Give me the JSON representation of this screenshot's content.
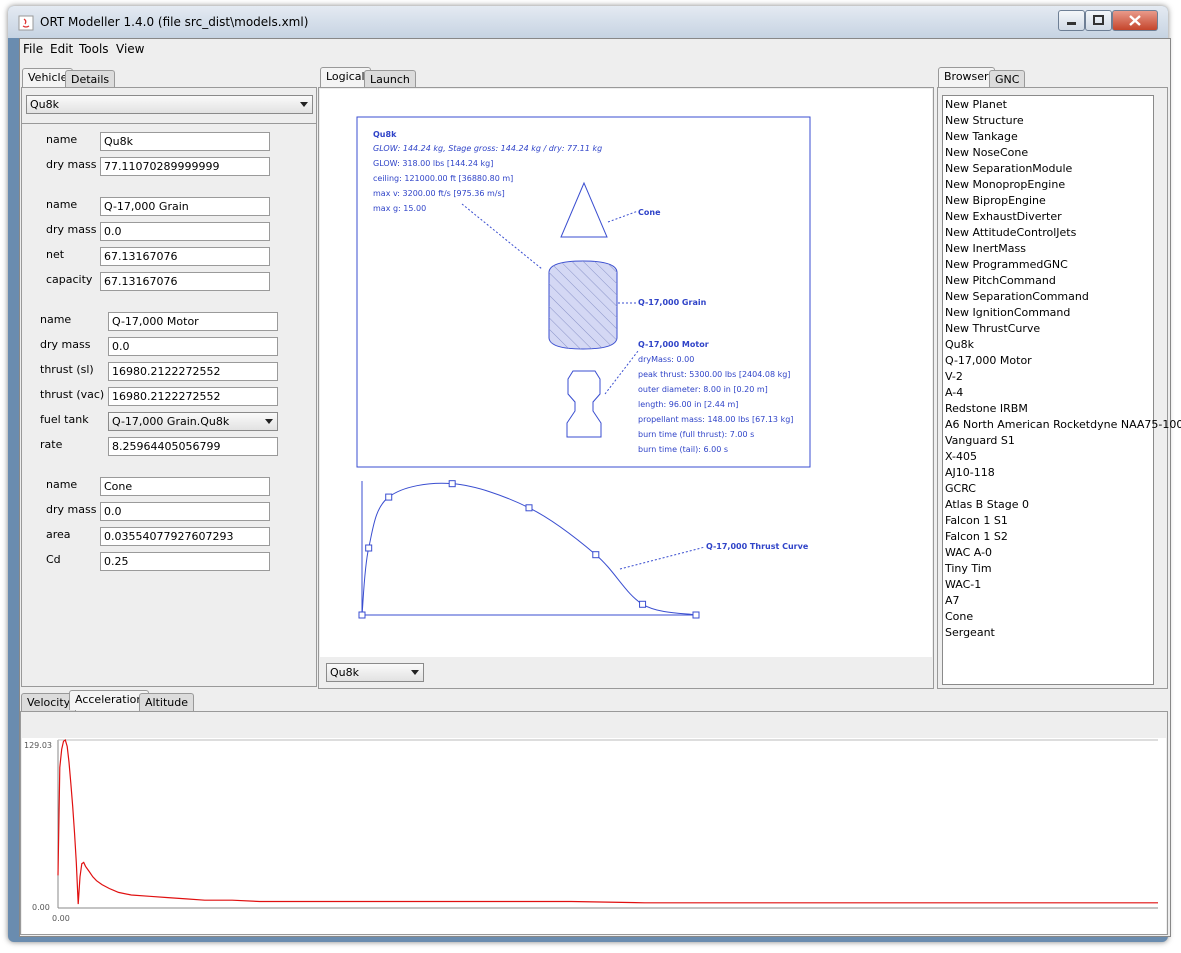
{
  "window": {
    "title": "ORT Modeller 1.4.0 (file src_dist\\models.xml)"
  },
  "menu": [
    "File",
    "Edit",
    "Tools",
    "View"
  ],
  "left": {
    "tabs": [
      "Vehicle",
      "Details"
    ],
    "selected_model": "Qu8k",
    "vehicle": {
      "name_label": "name",
      "name": "Qu8k",
      "dry_mass_label": "dry mass",
      "dry_mass": "77.11070289999999"
    },
    "tankage": {
      "name_label": "name",
      "name": "Q-17,000 Grain",
      "dry_mass_label": "dry mass",
      "dry_mass": "0.0",
      "net_label": "net",
      "net": "67.13167076",
      "capacity_label": "capacity",
      "capacity": "67.13167076"
    },
    "motor": {
      "name_label": "name",
      "name": "Q-17,000 Motor",
      "dry_mass_label": "dry mass",
      "dry_mass": "0.0",
      "thrust_sl_label": "thrust (sl)",
      "thrust_sl": "16980.2122272552",
      "thrust_vac_label": "thrust (vac)",
      "thrust_vac": "16980.2122272552",
      "fuel_tank_label": "fuel tank",
      "fuel_tank": "Q-17,000 Grain.Qu8k",
      "rate_label": "rate",
      "rate": "8.25964405056799"
    },
    "cone": {
      "name_label": "name",
      "name": "Cone",
      "dry_mass_label": "dry mass",
      "dry_mass": "0.0",
      "area_label": "area",
      "area": "0.03554077927607293",
      "cd_label": "Cd",
      "cd": "0.25"
    }
  },
  "center": {
    "tabs": [
      "Logical",
      "Launch"
    ],
    "selected_model": "Qu8k",
    "summary": {
      "name": "Qu8k",
      "line1": "GLOW: 144.24 kg, Stage gross: 144.24 kg / dry: 77.11 kg",
      "line2": "GLOW: 318.00 lbs [144.24 kg]",
      "line3": "ceiling: 121000.00 ft [36880.80 m]",
      "line4": "max v: 3200.00 ft/s [975.36 m/s]",
      "line5": "max g: 15.00"
    },
    "cone_label": "Cone",
    "grain_label": "Q-17,000 Grain",
    "motor_info": {
      "title": "Q-17,000 Motor",
      "l1": "dryMass: 0.00",
      "l2": "peak thrust: 5300.00 lbs [2404.08 kg]",
      "l3": "outer diameter: 8.00 in [0.20 m]",
      "l4": "length: 96.00 in [2.44 m]",
      "l5": "propellant mass: 148.00 lbs [67.13 kg]",
      "l6": "burn time (full thrust): 7.00 s",
      "l7": "burn time (tail): 6.00 s"
    },
    "thrust_curve_label": "Q-17,000 Thrust Curve",
    "thrust_curve_points": [
      [
        0,
        0
      ],
      [
        0.02,
        0.5
      ],
      [
        0.08,
        0.88
      ],
      [
        0.27,
        0.98
      ],
      [
        0.5,
        0.8
      ],
      [
        0.7,
        0.45
      ],
      [
        0.84,
        0.08
      ],
      [
        1.0,
        0
      ]
    ]
  },
  "right": {
    "tabs": [
      "Browser",
      "GNC"
    ],
    "items": [
      "New Planet",
      "New Structure",
      "New Tankage",
      "New NoseCone",
      "New SeparationModule",
      "New MonopropEngine",
      "New BipropEngine",
      "New ExhaustDiverter",
      "New AttitudeControlJets",
      "New InertMass",
      "New ProgrammedGNC",
      "New PitchCommand",
      "New SeparationCommand",
      "New IgnitionCommand",
      "New ThrustCurve",
      "Qu8k",
      "Q-17,000 Motor",
      "V-2",
      "A-4",
      "Redstone IRBM",
      "A6 North American Rocketdyne NAA75-100",
      "Vanguard S1",
      "X-405",
      "AJ10-118",
      "GCRC",
      "Atlas B Stage 0",
      "Falcon 1 S1",
      "Falcon 1 S2",
      "WAC A-0",
      "Tiny Tim",
      "WAC-1",
      "A7",
      "Cone",
      "Sergeant"
    ]
  },
  "bottom": {
    "tabs": [
      "Velocity",
      "Acceleration",
      "Altitude"
    ],
    "chart_data": {
      "type": "line",
      "title": "",
      "xlabel": "",
      "ylabel": "",
      "y_max_label": "129.03",
      "y_min_label": "0.00",
      "x_min_label": "0.00",
      "ylim": [
        0,
        129.03
      ],
      "series_color": "#e01010",
      "x": [
        0,
        1,
        2,
        3,
        4,
        5,
        6,
        7,
        8,
        9,
        10,
        11,
        12,
        13,
        14,
        15,
        17,
        19,
        21,
        24,
        28,
        33,
        40,
        50,
        60,
        70,
        80,
        95,
        110,
        130,
        160,
        200,
        240,
        280,
        320,
        360,
        400,
        440,
        480,
        520,
        560,
        600
      ],
      "y": [
        25,
        108,
        122,
        128,
        129,
        124,
        112,
        96,
        78,
        58,
        35,
        3,
        24,
        34,
        35,
        32,
        28,
        24,
        21,
        18,
        15,
        12,
        10,
        9,
        8,
        7,
        6,
        6,
        5,
        5,
        5,
        5,
        5,
        5,
        4,
        4,
        4,
        4,
        4,
        4,
        4,
        4
      ]
    }
  }
}
